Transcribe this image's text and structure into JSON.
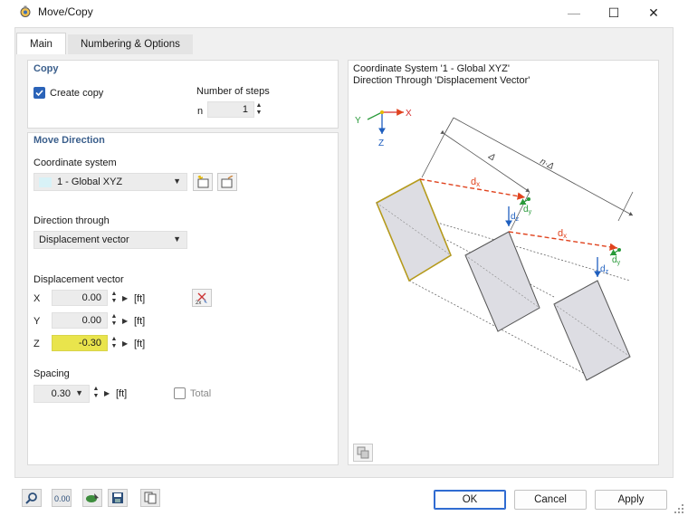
{
  "window": {
    "title": "Move/Copy"
  },
  "window_controls": {
    "minimize": "—",
    "maximize": "☐",
    "close": "✕"
  },
  "tabs": [
    {
      "label": "Main"
    },
    {
      "label": "Numbering & Options"
    }
  ],
  "copy": {
    "title": "Copy",
    "create_copy_label": "Create copy",
    "create_copy_checked": true,
    "steps_label": "Number of steps",
    "n_label": "n",
    "n_value": "1"
  },
  "move_direction": {
    "title": "Move Direction",
    "coord_label": "Coordinate system",
    "coord_value": "1 - Global XYZ",
    "direction_label": "Direction through",
    "direction_value": "Displacement vector",
    "displacement_label": "Displacement vector",
    "x_label": "X",
    "x_value": "0.00",
    "y_label": "Y",
    "y_value": "0.00",
    "z_label": "Z",
    "z_value": "-0.30",
    "unit": "[ft]",
    "spacing_label": "Spacing",
    "spacing_value": "0.30",
    "spacing_unit": "[ft]",
    "total_label": "Total",
    "total_checked": false
  },
  "diagram": {
    "line1": "Coordinate System '1 - Global XYZ'",
    "line2": "Direction Through 'Displacement Vector'",
    "axis_x": "X",
    "axis_y": "Y",
    "axis_z": "Z",
    "delta": "Δ",
    "n_delta": "n·Δ"
  },
  "buttons": {
    "ok": "OK",
    "cancel": "Cancel",
    "apply": "Apply"
  },
  "icons": {
    "app": "settings-icon",
    "new_cs": "new-coordinate-system-icon",
    "edit_cs": "edit-coordinate-system-icon",
    "pick": "pick-vector-icon",
    "diagram_tool": "diagram-options-icon",
    "bottom": [
      "search-icon",
      "decimal-places-icon",
      "render-icon",
      "save-icon",
      "copy-icon"
    ]
  },
  "colors": {
    "accent": "#2b63b8",
    "highlight_field": "#e9e44c",
    "group_title": "#3b5f8c",
    "arrow_red": "#e0431e",
    "axis_x": "#d62b2b",
    "axis_y": "#2a9a3a",
    "axis_z": "#1f5fbf"
  }
}
